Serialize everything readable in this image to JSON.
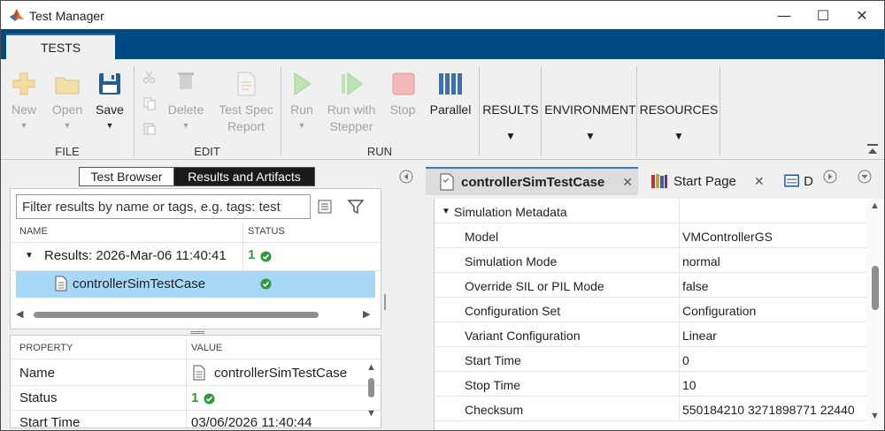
{
  "window": {
    "title": "Test Manager",
    "controls": {
      "minimize": "—",
      "maximize": "☐",
      "close": "✕"
    }
  },
  "ribbon_tab": {
    "label": "TESTS"
  },
  "toolstrip": {
    "file": {
      "label": "FILE",
      "new": "New",
      "open": "Open",
      "save": "Save"
    },
    "edit": {
      "label": "EDIT",
      "delete": "Delete",
      "test_spec_line1": "Test Spec",
      "test_spec_line2": "Report"
    },
    "run": {
      "label": "RUN",
      "run": "Run",
      "stepper_line1": "Run with",
      "stepper_line2": "Stepper",
      "stop": "Stop",
      "parallel": "Parallel"
    },
    "results": "RESULTS",
    "environment": "ENVIRONMENT",
    "resources": "RESOURCES"
  },
  "left": {
    "tabs": {
      "browser": "Test Browser",
      "artifacts": "Results and Artifacts"
    },
    "filter_placeholder": "Filter results by name or tags, e.g. tags: test",
    "columns": {
      "name": "NAME",
      "status": "STATUS"
    },
    "rows": [
      {
        "name": "Results: 2026-Mar-06 11:40:41",
        "status_count": "1"
      },
      {
        "name": "controllerSimTestCase",
        "status_count": ""
      }
    ],
    "properties": {
      "columns": {
        "property": "PROPERTY",
        "value": "VALUE"
      },
      "rows": [
        {
          "property": "Name",
          "value": "controllerSimTestCase"
        },
        {
          "property": "Status",
          "value": "1"
        },
        {
          "property": "Start Time",
          "value": "03/06/2026 11:40:44"
        }
      ]
    }
  },
  "right": {
    "tabs": [
      {
        "label": "controllerSimTestCase",
        "close": "✕"
      },
      {
        "label": "Start Page",
        "close": "✕"
      },
      {
        "label": "D"
      }
    ],
    "section_title": "Simulation Metadata",
    "rows": [
      {
        "key": "Model",
        "value": "VMControllerGS"
      },
      {
        "key": "Simulation Mode",
        "value": "normal"
      },
      {
        "key": "Override SIL or PIL Mode",
        "value": "false"
      },
      {
        "key": "Configuration Set",
        "value": "Configuration"
      },
      {
        "key": "Variant Configuration",
        "value": "Linear"
      },
      {
        "key": "Start Time",
        "value": "0"
      },
      {
        "key": "Stop Time",
        "value": "10"
      },
      {
        "key": "Checksum",
        "value": "550184210 3271898771 22440"
      }
    ]
  },
  "colors": {
    "accent": "#004a83",
    "selection": "#a8d8f8",
    "pass": "#2d9b3a"
  }
}
